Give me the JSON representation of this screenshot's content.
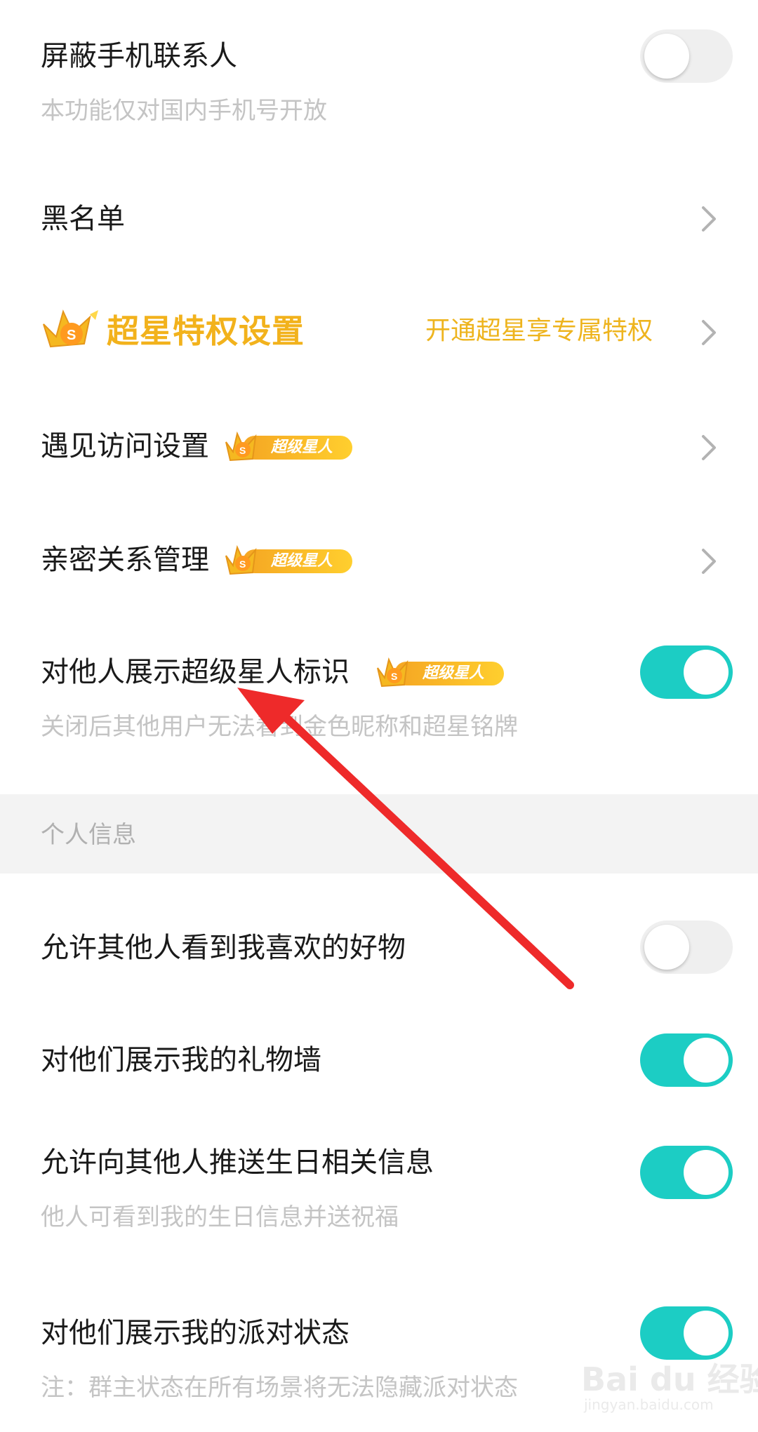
{
  "rows": {
    "block_contacts": {
      "title": "屏蔽手机联系人",
      "subtitle": "本功能仅对国内手机号开放",
      "toggle": "off"
    },
    "blacklist": {
      "title": "黑名单"
    },
    "super_star": {
      "title": "超星特权设置",
      "action": "开通超星享专属特权"
    },
    "meet_visit": {
      "title": "遇见访问设置",
      "badge": "超级星人"
    },
    "intimate": {
      "title": "亲密关系管理",
      "badge": "超级星人"
    },
    "show_badge": {
      "title": "对他人展示超级星人标识",
      "badge": "超级星人",
      "subtitle": "关闭后其他用户无法看到金色昵称和超星铭牌",
      "toggle": "on"
    }
  },
  "section": {
    "label": "个人信息"
  },
  "personal": {
    "liked_items": {
      "title": "允许其他人看到我喜欢的好物",
      "toggle": "off"
    },
    "gift_wall": {
      "title": "对他们展示我的礼物墙",
      "toggle": "on"
    },
    "birthday": {
      "title": "允许向其他人推送生日相关信息",
      "subtitle": "他人可看到我的生日信息并送祝福",
      "toggle": "on"
    },
    "party_status": {
      "title": "对他们展示我的派对状态",
      "subtitle": "注：群主状态在所有场景将无法隐藏派对状态",
      "toggle": "on"
    }
  },
  "watermark": {
    "brand": "Bai du 经验",
    "url": "jingyan.baidu.com"
  },
  "colors": {
    "toggle_on": "#1ccdc4",
    "toggle_off": "#efefef",
    "gold": "#f2b21c",
    "arrow": "#ee2a2a"
  },
  "icons": {
    "chevron": "chevron-right-icon",
    "crown": "crown-badge-icon"
  }
}
